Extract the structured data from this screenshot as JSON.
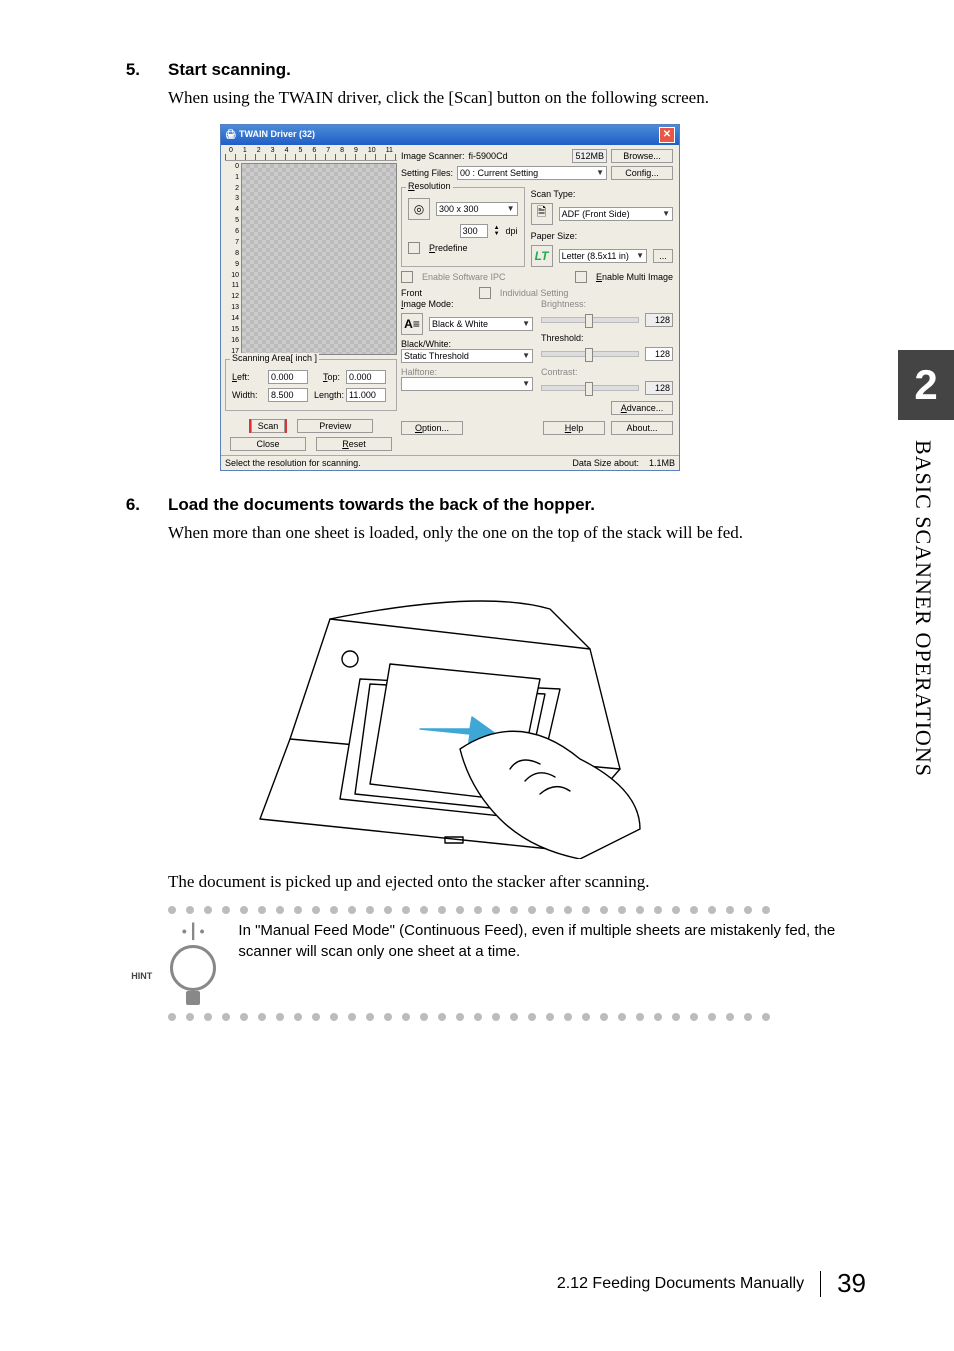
{
  "chapter_tab": "2",
  "side_label": "BASIC SCANNER OPERATIONS",
  "steps": {
    "s5": {
      "num": "5.",
      "title": "Start scanning.",
      "body": "When using the TWAIN driver, click the [Scan] button on the following screen."
    },
    "s6": {
      "num": "6.",
      "title": "Load the documents towards the back of the hopper.",
      "body": "When more than one sheet is loaded, only the one on the top of the stack will be fed.",
      "after": "The document is picked up and ejected onto the stacker after scanning."
    }
  },
  "twain": {
    "title": "TWAIN Driver (32)",
    "ruler": [
      "0",
      "1",
      "2",
      "3",
      "4",
      "5",
      "6",
      "7",
      "8",
      "9",
      "10",
      "11"
    ],
    "vruler": [
      "0",
      "1",
      "2",
      "3",
      "4",
      "5",
      "6",
      "7",
      "8",
      "9",
      "10",
      "11",
      "12",
      "13",
      "14",
      "15",
      "16",
      "17"
    ],
    "image_scanner_lbl": "Image Scanner:",
    "image_scanner_val": "fi-5900Cd",
    "mem": "512MB",
    "browse": "Browse...",
    "setting_files_lbl": "Setting Files:",
    "setting_files_val": "00 : Current Setting",
    "config": "Config...",
    "resolution_lbl": "Resolution",
    "resolution_val": "300 x 300",
    "dpi_val": "300",
    "dpi_lbl": "dpi",
    "predefine": "Predefine",
    "scan_type_lbl": "Scan Type:",
    "scan_type_val": "ADF (Front Side)",
    "paper_size_lbl": "Paper Size:",
    "paper_size_val": "Letter (8.5x11 in)",
    "enable_sw_ipc": "Enable Software IPC",
    "enable_multi": "Enable Multi Image",
    "front_lbl": "Front",
    "individual": "Individual Setting",
    "image_mode_lbl": "Image Mode:",
    "image_mode_val": "Black & White",
    "bw_lbl": "Black/White:",
    "bw_val": "Static Threshold",
    "halftone_lbl": "Halftone:",
    "brightness_lbl": "Brightness:",
    "brightness_val": "128",
    "threshold_lbl": "Threshold:",
    "threshold_val": "128",
    "contrast_lbl": "Contrast:",
    "contrast_val": "128",
    "advance": "Advance...",
    "scanning_area_lbl": "Scanning Area[ inch ]",
    "left_lbl": "Left:",
    "left_val": "0.000",
    "top_lbl": "Top:",
    "top_val": "0.000",
    "width_lbl": "Width:",
    "width_val": "8.500",
    "length_lbl": "Length:",
    "length_val": "11.000",
    "scan": "Scan",
    "preview": "Preview",
    "close": "Close",
    "reset": "Reset",
    "option": "Option...",
    "help": "Help",
    "about": "About...",
    "status_left": "Select the resolution for scanning.",
    "status_right_lbl": "Data Size about:",
    "status_right_val": "1.1MB"
  },
  "hint": {
    "label": "HINT",
    "text": "In \"Manual Feed Mode\" (Continuous Feed), even if multiple sheets are mistakenly fed, the scanner will scan only one sheet at a time."
  },
  "footer": {
    "section": "2.12 Feeding Documents Manually",
    "page": "39"
  }
}
